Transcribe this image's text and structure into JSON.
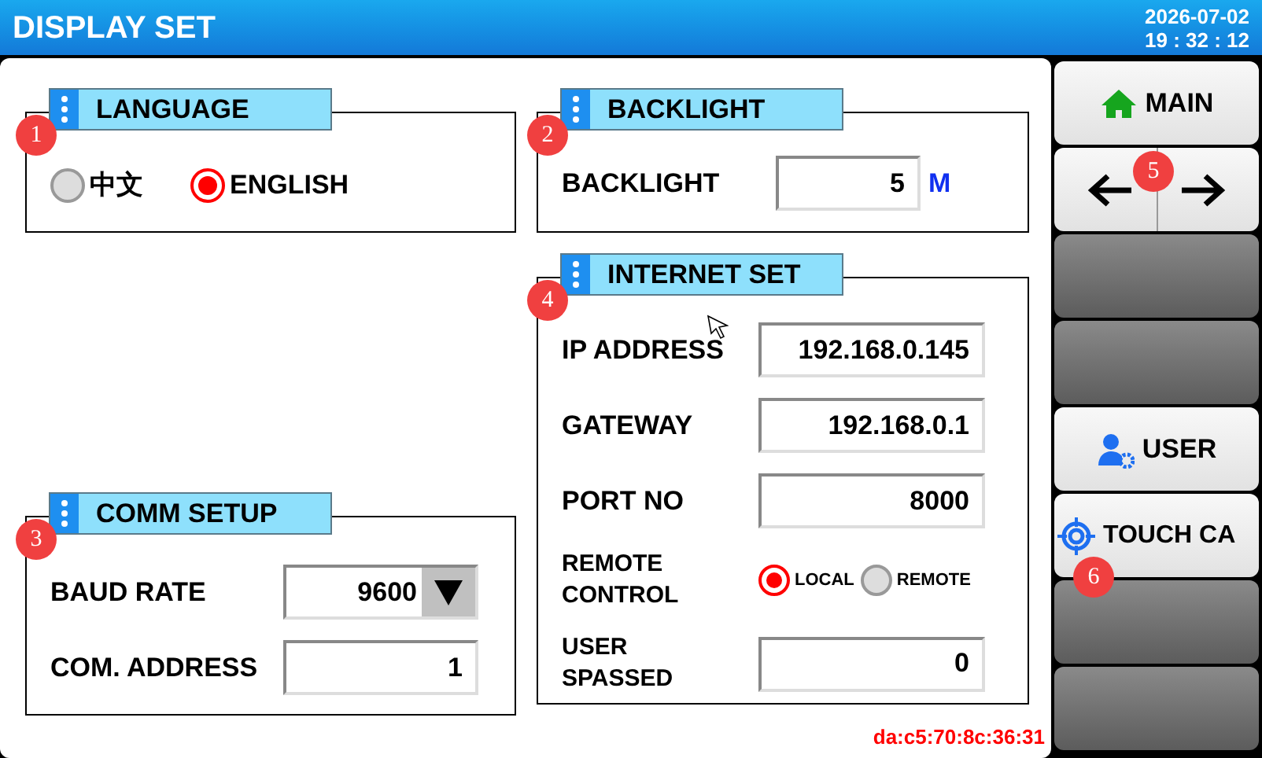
{
  "header": {
    "title": "DISPLAY SET",
    "date": "2026-07-02",
    "time": "19 : 32 : 12"
  },
  "language": {
    "title": "LANGUAGE",
    "callout": "1",
    "options": [
      {
        "label": "中文",
        "selected": false
      },
      {
        "label": "ENGLISH",
        "selected": true
      }
    ]
  },
  "backlight": {
    "title": "BACKLIGHT",
    "callout": "2",
    "label": "BACKLIGHT",
    "value": "5",
    "unit": "M"
  },
  "internet_set": {
    "title": "INTERNET SET",
    "callout": "4",
    "rows": [
      {
        "kind": "field",
        "label": "IP ADDRESS",
        "value": "192.168.0.145"
      },
      {
        "kind": "field",
        "label": "GATEWAY",
        "value": "192.168.0.1"
      },
      {
        "kind": "field",
        "label": "PORT NO",
        "value": "8000"
      },
      {
        "kind": "radio",
        "label": "REMOTE CONTROL",
        "options": [
          {
            "label": "LOCAL",
            "selected": true
          },
          {
            "label": "REMOTE",
            "selected": false
          }
        ]
      },
      {
        "kind": "field",
        "label": "USER SPASSED",
        "value": "0"
      }
    ]
  },
  "comm_setup": {
    "title": "COMM SETUP",
    "callout": "3",
    "rows": [
      {
        "kind": "dropdown",
        "label": "BAUD RATE",
        "value": "9600"
      },
      {
        "kind": "field",
        "label": "COM. ADDRESS",
        "value": "1"
      }
    ]
  },
  "mac_address": "da:c5:70:8c:36:31",
  "sidebar": [
    {
      "kind": "home",
      "label": "MAIN"
    },
    {
      "kind": "arrows",
      "callout": "5"
    },
    {
      "kind": "blank"
    },
    {
      "kind": "blank"
    },
    {
      "kind": "user",
      "label": "USER"
    },
    {
      "kind": "calibrate",
      "label": "TOUCH CA",
      "callout": "6"
    },
    {
      "kind": "blank"
    },
    {
      "kind": "blank"
    }
  ]
}
